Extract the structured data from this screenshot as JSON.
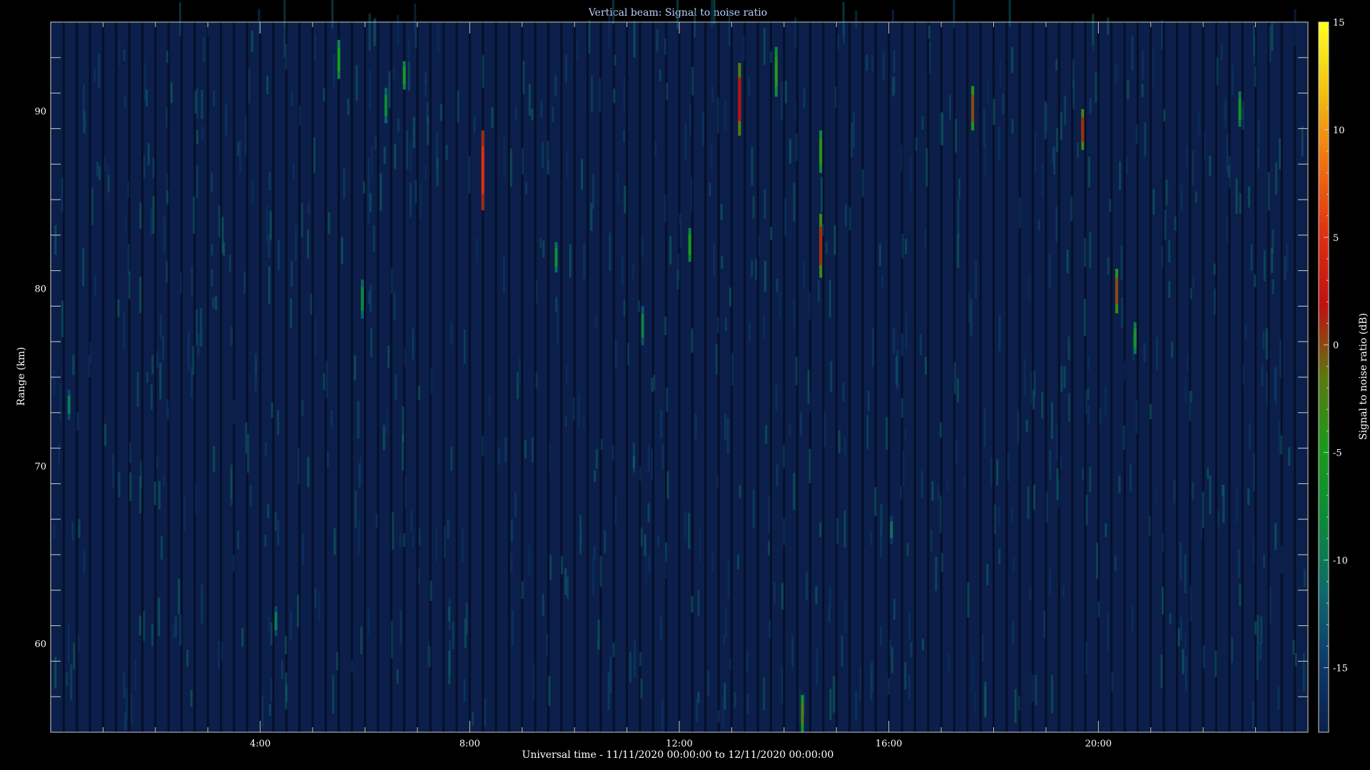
{
  "chart_data": {
    "type": "heatmap",
    "title": "Vertical beam: Signal to noise ratio",
    "xlabel": "Universal time - 11/11/2020 00:00:00 to 12/11/2020 00:00:00",
    "ylabel": "Range (km)",
    "xlim_hours": [
      0,
      24
    ],
    "ylim": [
      55,
      95
    ],
    "x_ticks": [
      {
        "hours": 4,
        "label": "4:00"
      },
      {
        "hours": 8,
        "label": "8:00"
      },
      {
        "hours": 12,
        "label": "12:00"
      },
      {
        "hours": 16,
        "label": "16:00"
      },
      {
        "hours": 20,
        "label": "20:00"
      }
    ],
    "y_ticks": [
      60,
      70,
      80,
      90
    ],
    "y_tick_labels": [
      "60",
      "70",
      "80",
      "90"
    ],
    "colorbar": {
      "label": "Signal to noise ratio (dB)",
      "range": [
        -18,
        15
      ],
      "ticks": [
        15,
        10,
        5,
        0,
        -5,
        -10,
        -15
      ],
      "tick_labels": [
        "15",
        "10",
        "5",
        "0",
        "-5",
        "-10",
        "-15"
      ],
      "colors": [
        "#0b1f4a",
        "#0d3a6a",
        "#0e6a6a",
        "#0c8a3a",
        "#1a9a1a",
        "#5a7a10",
        "#c01010",
        "#e03010",
        "#f07010",
        "#f0c010",
        "#ffff20"
      ]
    },
    "background_snr_db": -16,
    "features": [
      {
        "hour": 5.5,
        "km_low": 91.8,
        "km_high": 94.0,
        "snr_db": -5
      },
      {
        "hour": 6.4,
        "km_low": 89.3,
        "km_high": 91.3,
        "snr_db": -8
      },
      {
        "hour": 6.75,
        "km_low": 91.2,
        "km_high": 92.8,
        "snr_db": -5
      },
      {
        "hour": 8.25,
        "km_low": 84.4,
        "km_high": 88.9,
        "snr_db": 5
      },
      {
        "hour": 5.95,
        "km_low": 78.3,
        "km_high": 80.5,
        "snr_db": -8
      },
      {
        "hour": 9.65,
        "km_low": 80.9,
        "km_high": 82.6,
        "snr_db": -7
      },
      {
        "hour": 11.3,
        "km_low": 76.8,
        "km_high": 79.0,
        "snr_db": -9
      },
      {
        "hour": 12.2,
        "km_low": 81.5,
        "km_high": 83.4,
        "snr_db": -5
      },
      {
        "hour": 13.15,
        "km_low": 88.6,
        "km_high": 92.7,
        "snr_db": 2
      },
      {
        "hour": 13.85,
        "km_low": 90.8,
        "km_high": 93.6,
        "snr_db": -4
      },
      {
        "hour": 14.7,
        "km_low": 86.5,
        "km_high": 88.9,
        "snr_db": -4
      },
      {
        "hour": 14.7,
        "km_low": 80.6,
        "km_high": 84.2,
        "snr_db": 1
      },
      {
        "hour": 14.35,
        "km_low": 55.0,
        "km_high": 57.1,
        "snr_db": -2
      },
      {
        "hour": 17.6,
        "km_low": 88.9,
        "km_high": 91.4,
        "snr_db": 0
      },
      {
        "hour": 19.7,
        "km_low": 87.8,
        "km_high": 90.1,
        "snr_db": 1
      },
      {
        "hour": 20.35,
        "km_low": 78.6,
        "km_high": 81.1,
        "snr_db": 0
      },
      {
        "hour": 20.7,
        "km_low": 76.3,
        "km_high": 78.1,
        "snr_db": -6
      },
      {
        "hour": 22.7,
        "km_low": 89.1,
        "km_high": 91.1,
        "snr_db": -6
      },
      {
        "hour": 0.35,
        "km_low": 72.6,
        "km_high": 74.3,
        "snr_db": -10
      },
      {
        "hour": 4.3,
        "km_low": 60.4,
        "km_high": 62.1,
        "snr_db": -10
      },
      {
        "hour": 16.05,
        "km_low": 65.6,
        "km_high": 67.2,
        "snr_db": -11
      }
    ]
  }
}
